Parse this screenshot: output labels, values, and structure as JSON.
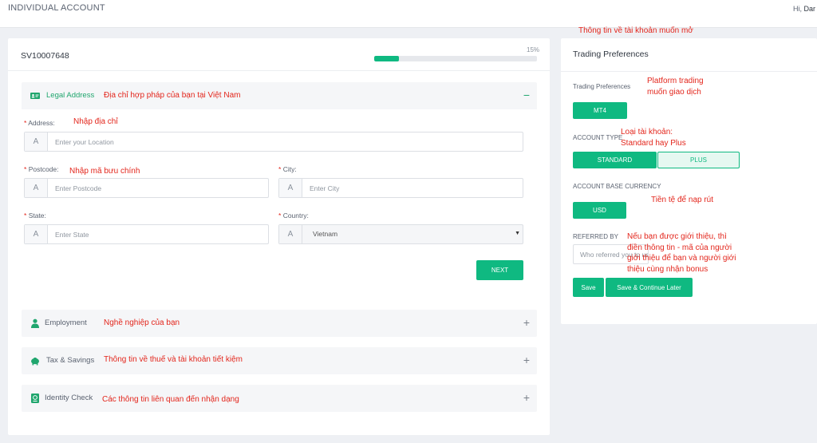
{
  "header": {
    "title": "INDIVIDUAL ACCOUNT",
    "greeting": "Hi,",
    "user_name": "Dar"
  },
  "form_card": {
    "account_id": "SV10007648",
    "progress_label": "15%",
    "progress_value": 0.15
  },
  "legal_address": {
    "title": "Legal Address",
    "toggle": "−",
    "address_label": "Address:",
    "address_placeholder": "Enter your Location",
    "postcode_label": "Postcode:",
    "postcode_placeholder": "Enter Postcode",
    "city_label": "City:",
    "city_placeholder": "Enter City",
    "state_label": "State:",
    "state_placeholder": "Enter State",
    "country_label": "Country:",
    "country_value": "Vietnam",
    "next_label": "NEXT",
    "required_mark": "*"
  },
  "sections": {
    "employment": {
      "title": "Employment",
      "toggle": "+"
    },
    "tax_savings": {
      "title": "Tax & Savings",
      "toggle": "+"
    },
    "identity_check": {
      "title": "Identity Check",
      "toggle": "+"
    }
  },
  "preferences": {
    "title": "Trading Preferences",
    "platform_label": "Trading Preferences",
    "platform_value": "MT4",
    "account_type_label": "ACCOUNT TYPE",
    "account_type_options": [
      "STANDARD",
      "PLUS"
    ],
    "currency_label": "ACCOUNT BASE CURRENCY",
    "currency_value": "USD",
    "referred_label": "REFERRED BY",
    "referred_placeholder": "Who referred you to us ?",
    "save_label": "Save",
    "save_continue_label": "Save & Continue Later"
  },
  "annotations": {
    "top": "Thông tin về tài khoản muốn mở",
    "legal_address": "Địa chỉ hợp pháp của bạn tại Việt Nam",
    "address": "Nhập địa chỉ",
    "postcode": "Nhập mã bưu chính",
    "employment": "Nghề  nghiệp của bạn",
    "tax": "Thông tin về thuế và tài khoản tiết kiệm",
    "identity": "Các thông tin liên quan đến nhận dạng",
    "platform": [
      "Platform trading",
      "muốn giao dịch"
    ],
    "account_type": [
      "Loại tài khoản:",
      "Standard hay Plus"
    ],
    "currency": "Tiền tệ để nạp rút",
    "referral": [
      "Nếu bạn được giới thiệu, thì",
      "điền thông tin - mã của người",
      "giới thiệu để bạn và người giới",
      "thiệu cùng nhận bonus"
    ]
  },
  "colors": {
    "accent": "#0fb981",
    "annotation": "#e3261c",
    "background": "#eef0f4"
  }
}
